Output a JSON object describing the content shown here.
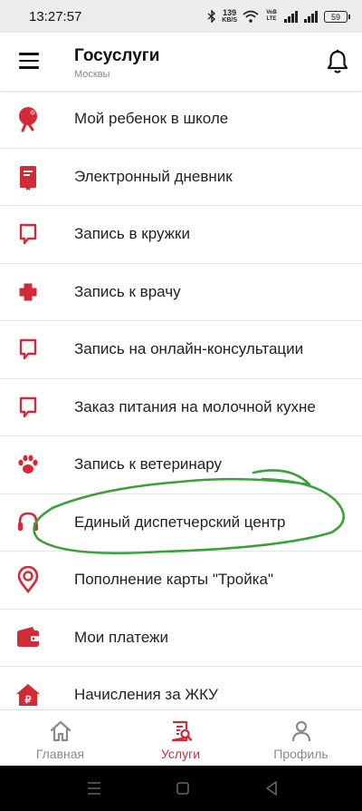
{
  "status_bar": {
    "time": "13:27:57",
    "net_speed_value": "139",
    "net_speed_unit": "KB/S",
    "volte": "VoB LTE",
    "battery": "59"
  },
  "app_bar": {
    "title": "Госуслуги",
    "subtitle": "Москвы",
    "menu_icon": "hamburger-menu-icon",
    "bell_icon": "bell-icon"
  },
  "services": [
    {
      "label": "Мой ребенок в школе",
      "icon": "school-bell-icon"
    },
    {
      "label": "Электронный дневник",
      "icon": "diary-book-icon"
    },
    {
      "label": "Запись в кружки",
      "icon": "speech-bubble-icon"
    },
    {
      "label": "Запись к врачу",
      "icon": "medical-cross-icon"
    },
    {
      "label": "Запись на онлайн-консультации",
      "icon": "speech-bubble-icon"
    },
    {
      "label": "Заказ питания на молочной кухне",
      "icon": "speech-bubble-icon"
    },
    {
      "label": "Запись к ветеринару",
      "icon": "paw-icon"
    },
    {
      "label": "Единый диспетчерский центр",
      "icon": "headset-icon"
    },
    {
      "label": "Пополнение карты \"Тройка\"",
      "icon": "location-pin-icon"
    },
    {
      "label": "Мои платежи",
      "icon": "wallet-icon"
    },
    {
      "label": "Начисления за ЖКУ",
      "icon": "house-ruble-icon"
    }
  ],
  "bottom_nav": [
    {
      "label": "Главная",
      "icon": "home-icon",
      "active": false
    },
    {
      "label": "Услуги",
      "icon": "services-icon",
      "active": true
    },
    {
      "label": "Профиль",
      "icon": "profile-icon",
      "active": false
    }
  ],
  "colors": {
    "accent": "#d32a37",
    "inactive": "#8a8a8a",
    "annotation": "#3aa03a"
  }
}
